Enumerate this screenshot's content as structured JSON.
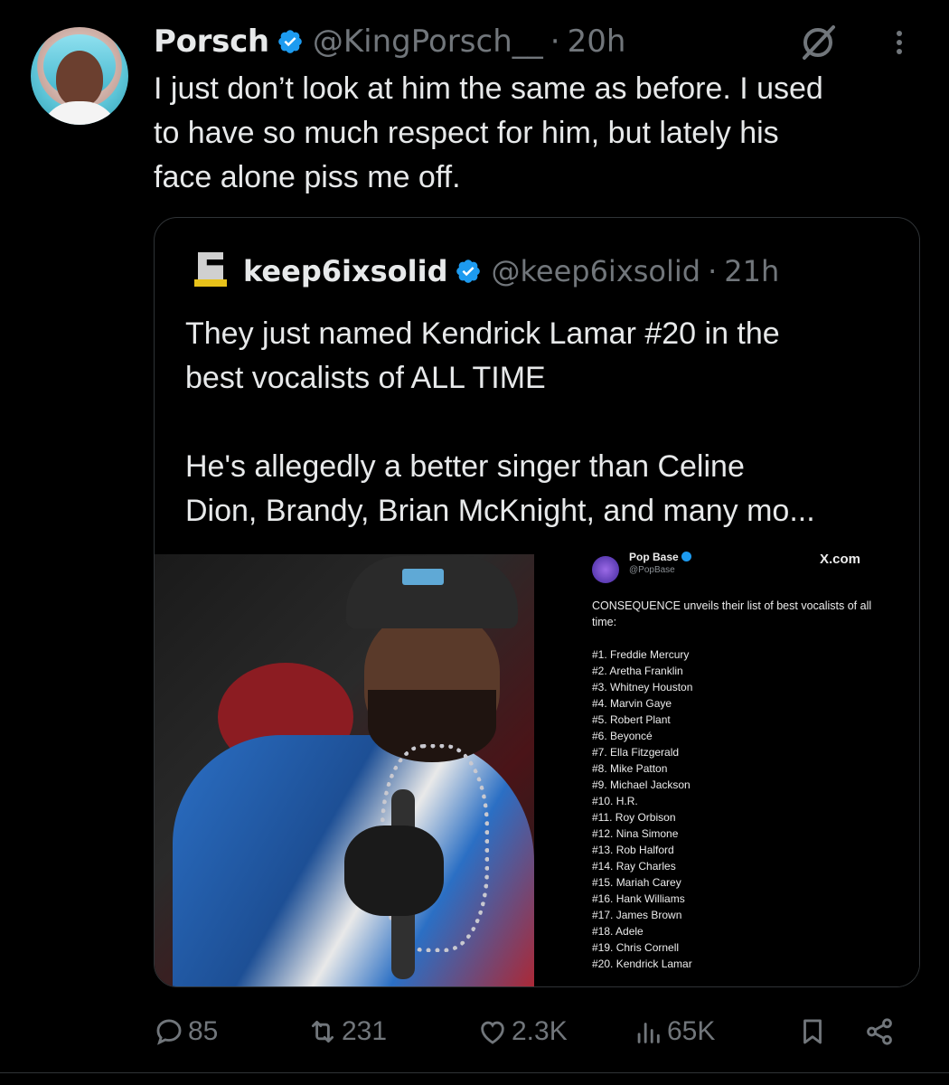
{
  "tweet": {
    "author_name": "Porsch",
    "author_handle": "@KingPorsch__",
    "dot": "·",
    "time": "20h",
    "text": "I just don’t look at him the same as before. I used\nto have so much respect for him, but lately his\nface alone piss me off."
  },
  "quote": {
    "author_name": "keep6ixsolid",
    "author_handle": "@keep6ixsolid",
    "dot": "·",
    "time": "21h",
    "text": "They just named Kendrick Lamar #20 in the\nbest vocalists of ALL TIME\n\nHe's allegedly a better singer than Celine\nDion, Brandy, Brian McKnight, and many mo...",
    "media": {
      "popbase_name": "Pop Base",
      "popbase_handle": "@PopBase",
      "site": "X.com",
      "intro": "CONSEQUENCE unveils their list of best vocalists of all time:",
      "list": [
        "#1. Freddie Mercury",
        "#2. Aretha Franklin",
        "#3. Whitney Houston",
        "#4. Marvin Gaye",
        "#5. Robert Plant",
        "#6. Beyoncé",
        "#7. Ella Fitzgerald",
        "#8. Mike Patton",
        "#9. Michael Jackson",
        "#10. H.R.",
        "#11. Roy Orbison",
        "#12. Nina Simone",
        "#13. Rob Halford",
        "#14. Ray Charles",
        "#15. Mariah Carey",
        "#16. Hank Williams",
        "#17. James Brown",
        "#18. Adele",
        "#19. Chris Cornell",
        "#20. Kendrick Lamar"
      ]
    }
  },
  "actions": {
    "replies": "85",
    "reposts": "231",
    "likes": "2.3K",
    "views": "65K"
  },
  "icons": {
    "verified": "verified-badge-icon",
    "grok": "grok-icon",
    "more": "more-options-icon",
    "reply": "reply-icon",
    "repost": "repost-icon",
    "like": "like-icon",
    "views": "views-icon",
    "bookmark": "bookmark-icon",
    "share": "share-icon"
  },
  "colors": {
    "background": "#000000",
    "text": "#e7e9ea",
    "muted": "#71767b",
    "border": "#2f3336",
    "verified": "#1d9bf0"
  }
}
